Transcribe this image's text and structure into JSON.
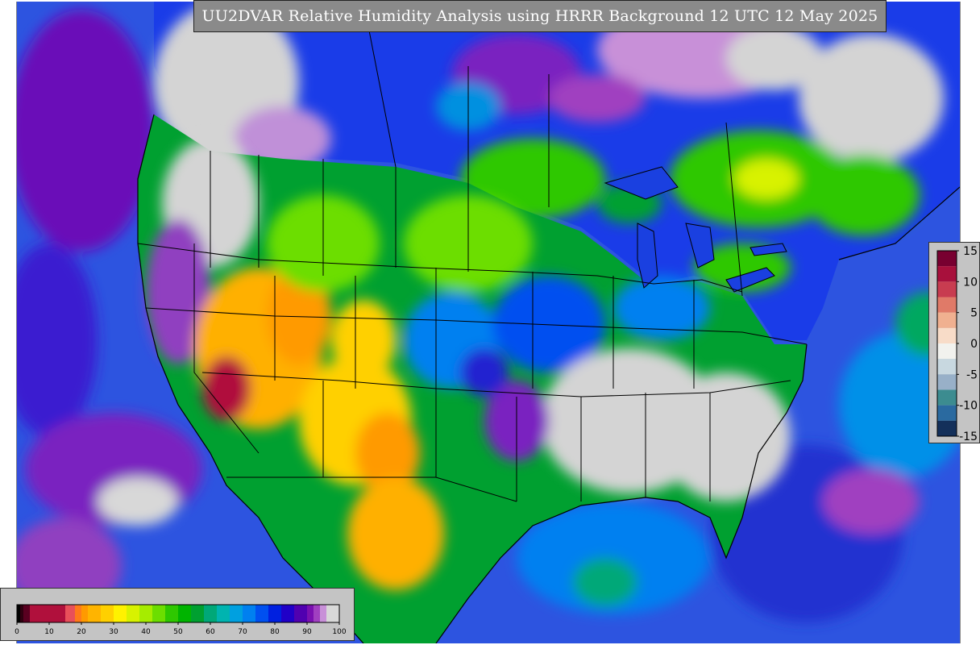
{
  "title": "UU2DVAR Relative Humidity Analysis using HRRR Background 12 UTC 12 May 2025",
  "rh_legend": {
    "min": 0,
    "max": 100,
    "ticks": [
      "0",
      "10",
      "20",
      "30",
      "40",
      "50",
      "60",
      "70",
      "80",
      "90",
      "100"
    ],
    "bins": [
      {
        "from": 0,
        "to": 1,
        "color": "#000000"
      },
      {
        "from": 1,
        "to": 2,
        "color": "#300010"
      },
      {
        "from": 2,
        "to": 4,
        "color": "#5a0020"
      },
      {
        "from": 4,
        "to": 15,
        "color": "#b0103c"
      },
      {
        "from": 15,
        "to": 18,
        "color": "#e8505a"
      },
      {
        "from": 18,
        "to": 20,
        "color": "#ff7a1a"
      },
      {
        "from": 20,
        "to": 22,
        "color": "#ff9a00"
      },
      {
        "from": 22,
        "to": 26,
        "color": "#ffb400"
      },
      {
        "from": 26,
        "to": 30,
        "color": "#ffd000"
      },
      {
        "from": 30,
        "to": 34,
        "color": "#fff200"
      },
      {
        "from": 34,
        "to": 38,
        "color": "#d8f200"
      },
      {
        "from": 38,
        "to": 42,
        "color": "#a6ec00"
      },
      {
        "from": 42,
        "to": 46,
        "color": "#6cde00"
      },
      {
        "from": 46,
        "to": 50,
        "color": "#2ec800"
      },
      {
        "from": 50,
        "to": 54,
        "color": "#00b400"
      },
      {
        "from": 54,
        "to": 58,
        "color": "#00a030"
      },
      {
        "from": 58,
        "to": 62,
        "color": "#00a878"
      },
      {
        "from": 62,
        "to": 66,
        "color": "#00b4b0"
      },
      {
        "from": 66,
        "to": 70,
        "color": "#00a0e0"
      },
      {
        "from": 70,
        "to": 74,
        "color": "#0080f0"
      },
      {
        "from": 74,
        "to": 78,
        "color": "#0050f0"
      },
      {
        "from": 78,
        "to": 82,
        "color": "#0020e0"
      },
      {
        "from": 82,
        "to": 86,
        "color": "#2000c8"
      },
      {
        "from": 86,
        "to": 90,
        "color": "#5000b0"
      },
      {
        "from": 90,
        "to": 92,
        "color": "#7a10b0"
      },
      {
        "from": 92,
        "to": 94,
        "color": "#a040c0"
      },
      {
        "from": 94,
        "to": 96,
        "color": "#c890d8"
      },
      {
        "from": 96,
        "to": 100,
        "color": "#d8d8d8"
      }
    ]
  },
  "diff_legend": {
    "min": -15,
    "max": 15,
    "ticks": [
      "15",
      "10",
      "5",
      "0",
      "-5",
      "-10",
      "-15"
    ],
    "bins": [
      {
        "from": 12.5,
        "to": 15,
        "color": "#780030"
      },
      {
        "from": 10,
        "to": 12.5,
        "color": "#a8103c"
      },
      {
        "from": 7.5,
        "to": 10,
        "color": "#c83c50"
      },
      {
        "from": 5,
        "to": 7.5,
        "color": "#e07a68"
      },
      {
        "from": 2.5,
        "to": 5,
        "color": "#f0b090"
      },
      {
        "from": 0,
        "to": 2.5,
        "color": "#f8dcc8"
      },
      {
        "from": -2.5,
        "to": 0,
        "color": "#f2f2ee"
      },
      {
        "from": -5,
        "to": -2.5,
        "color": "#c8d8e0"
      },
      {
        "from": -7.5,
        "to": -5,
        "color": "#98b0c8"
      },
      {
        "from": -10,
        "to": -7.5,
        "color": "#3c8c90"
      },
      {
        "from": -12.5,
        "to": -10,
        "color": "#2a6aa0"
      },
      {
        "from": -15,
        "to": -12.5,
        "color": "#14305a"
      }
    ]
  },
  "colors": {
    "ocean": "#2d54e0",
    "land_moist": "#d4d4d4",
    "arid": "#ffb000",
    "border": "#000000"
  }
}
